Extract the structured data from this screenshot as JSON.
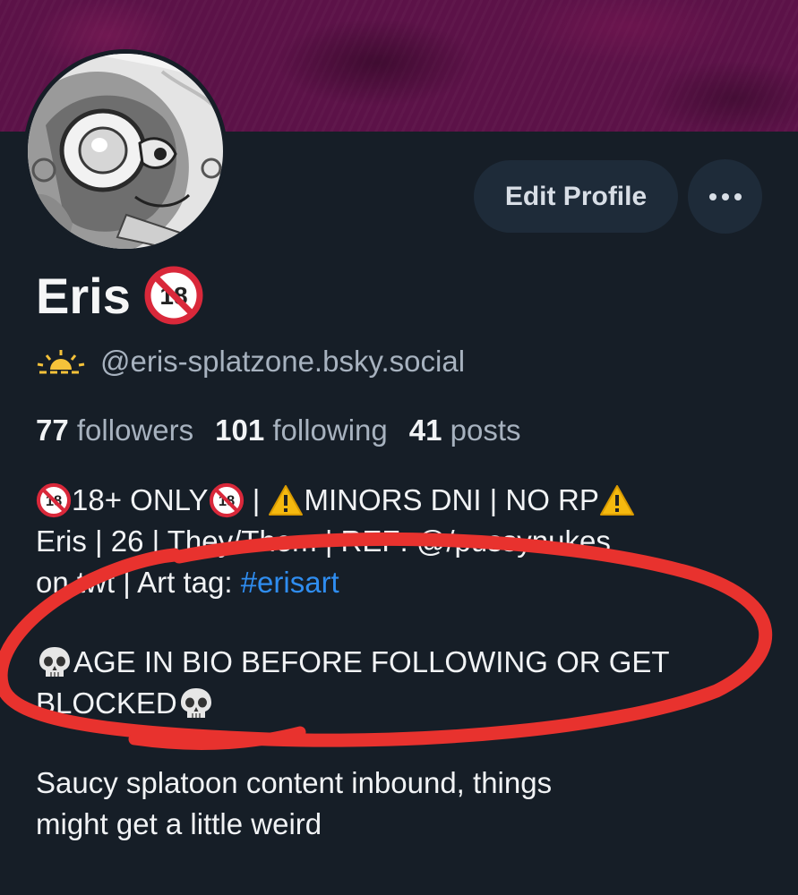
{
  "profile": {
    "name": "Eris",
    "handle": "@eris-splatzone.bsky.social",
    "edit_label": "Edit Profile"
  },
  "stats": {
    "followers_count": "77",
    "followers_label": "followers",
    "following_count": "101",
    "following_label": "following",
    "posts_count": "41",
    "posts_label": "posts"
  },
  "bio": {
    "line1_a": "18+ ONLY",
    "line1_b": " | ",
    "line1_c": "MINORS DNI | NO RP",
    "line2": "Eris | 26 | They/Them | REF: @/pussynukes",
    "line3_a": "on twt | Art tag: ",
    "hashtag": "#erisart",
    "line4": "AGE IN BIO BEFORE FOLLOWING OR GET",
    "line5": "BLOCKED",
    "line6": "Saucy splatoon content inbound, things",
    "line7": "might get a little weird"
  },
  "colors": {
    "banner": "#5c1248",
    "background": "#161e27",
    "button_bg": "#1e2b39",
    "link": "#2f8df0",
    "annotation": "#e8322e"
  },
  "icons": [
    "no-under-18-icon",
    "sunrise-icon",
    "warning-icon",
    "skull-icon",
    "more-dots-icon"
  ]
}
